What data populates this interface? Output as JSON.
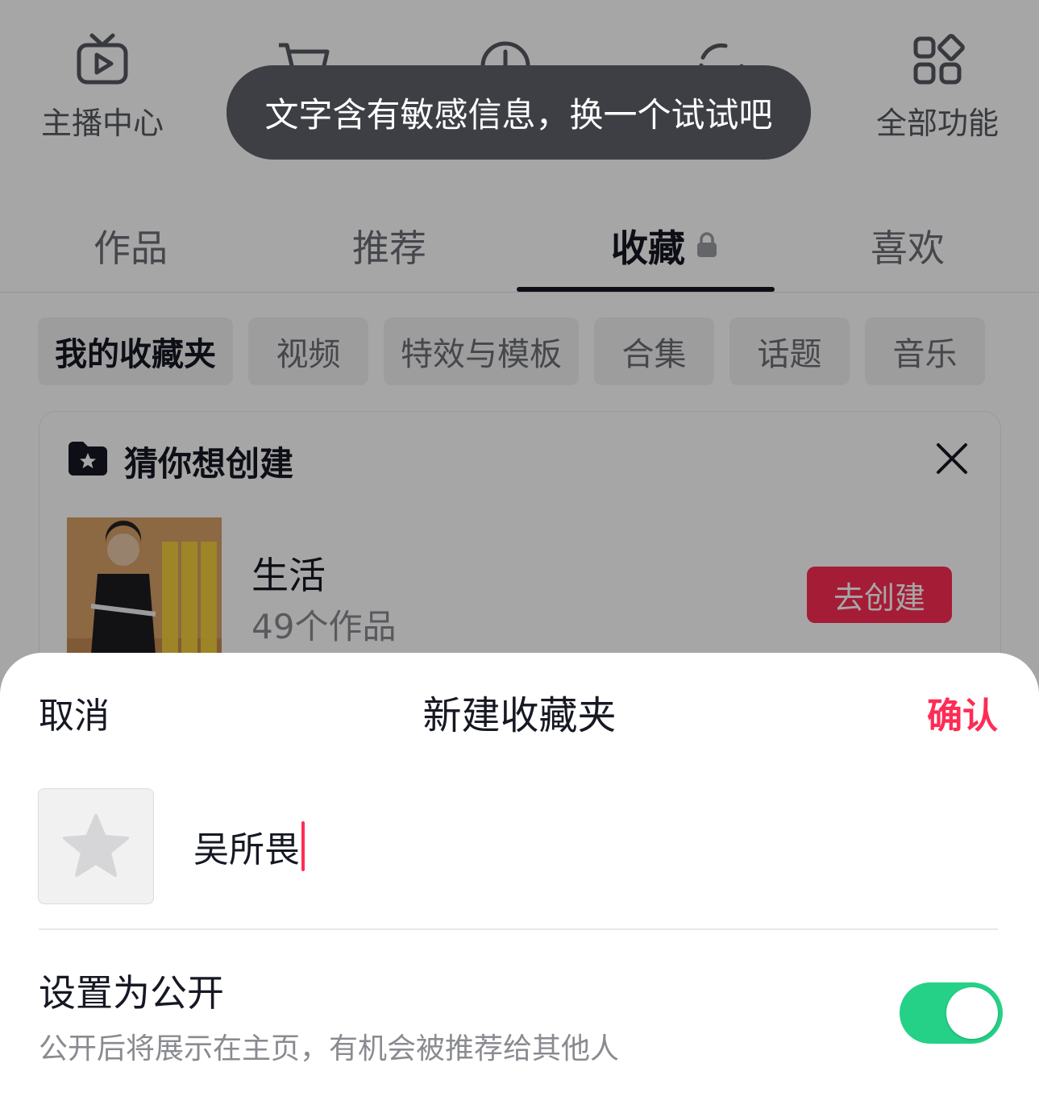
{
  "shortcuts": {
    "streamer_center": "主播中心",
    "all_features": "全部功能"
  },
  "toast": {
    "text": "文字含有敏感信息，换一个试试吧"
  },
  "tabs": [
    {
      "label": "作品"
    },
    {
      "label": "推荐"
    },
    {
      "label": "收藏"
    },
    {
      "label": "喜欢"
    }
  ],
  "active_tab": "收藏",
  "chips": [
    {
      "label": "我的收藏夹"
    },
    {
      "label": "视频"
    },
    {
      "label": "特效与模板"
    },
    {
      "label": "合集"
    },
    {
      "label": "话题"
    },
    {
      "label": "音乐"
    }
  ],
  "suggestion": {
    "title": "猜你想创建",
    "name": "生活",
    "count": "49个作品",
    "button": "去创建"
  },
  "sheet": {
    "cancel": "取消",
    "title": "新建收藏夹",
    "confirm": "确认",
    "name_value": "吴所畏",
    "public_label": "设置为公开",
    "public_desc": "公开后将展示在主页，有机会被推荐给其他人",
    "public_on": true
  },
  "colors": {
    "accent": "#fe2c55",
    "toggle_on": "#25d187",
    "toast_bg": "#3d3f45"
  }
}
